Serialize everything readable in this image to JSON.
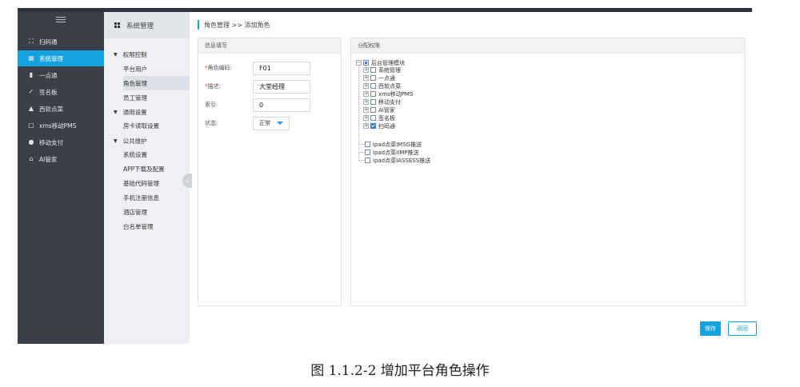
{
  "sidebar": {
    "items": [
      {
        "label": "扫码通",
        "icon": "scan-icon"
      },
      {
        "label": "系统管理",
        "icon": "grid-icon",
        "active": true
      },
      {
        "label": "一点通",
        "icon": "bar-chart-icon"
      },
      {
        "label": "签名板",
        "icon": "pen-icon"
      },
      {
        "label": "西软点菜",
        "icon": "triangle-icon"
      },
      {
        "label": "xms移动PMS",
        "icon": "square-icon"
      },
      {
        "label": "移动支付",
        "icon": "dollar-icon"
      },
      {
        "label": "AI管家",
        "icon": "home-icon"
      }
    ]
  },
  "subnav": {
    "title": "系统管理",
    "groups": [
      {
        "label": "权限控制",
        "items": [
          "平台用户",
          "角色管理",
          "员工管理"
        ]
      },
      {
        "label": "通用设置",
        "items": [
          "房卡读取设置"
        ]
      },
      {
        "label": "公共维护",
        "items": [
          "系统设置",
          "APP下载及配置",
          "基础代码管理",
          "手机注册信息",
          "酒店管理",
          "白名单管理"
        ]
      }
    ]
  },
  "breadcrumb": "角色管理 >> 添加角色",
  "info_panel": {
    "title": "信息填写",
    "fields": {
      "code": {
        "label": "角色编码:",
        "value": "F01"
      },
      "desc": {
        "label": "描述:",
        "value": "大堂经理"
      },
      "index": {
        "label": "索引:",
        "value": "0"
      },
      "status": {
        "label": "状态:",
        "value": "正常"
      }
    }
  },
  "perm_panel": {
    "title": "分配权限",
    "tree": {
      "root": "后台管理模块",
      "children": [
        "系统管理",
        "一点通",
        "西软点菜",
        "xms移动PMS",
        "移动支付",
        "AI管家",
        "签名板",
        "扫码通"
      ],
      "others": [
        "ipad点菜IMSG推送",
        "ipad点菜IIMP推送",
        "ipad点菜IASSESS推送"
      ]
    }
  },
  "buttons": {
    "save": "保存",
    "back": "返回"
  },
  "caption": "图 1.1.2-2  增加平台角色操作",
  "colors": {
    "accent": "#14a3de",
    "sidebar": "#3a3f4a",
    "check": "#3a78d8"
  }
}
